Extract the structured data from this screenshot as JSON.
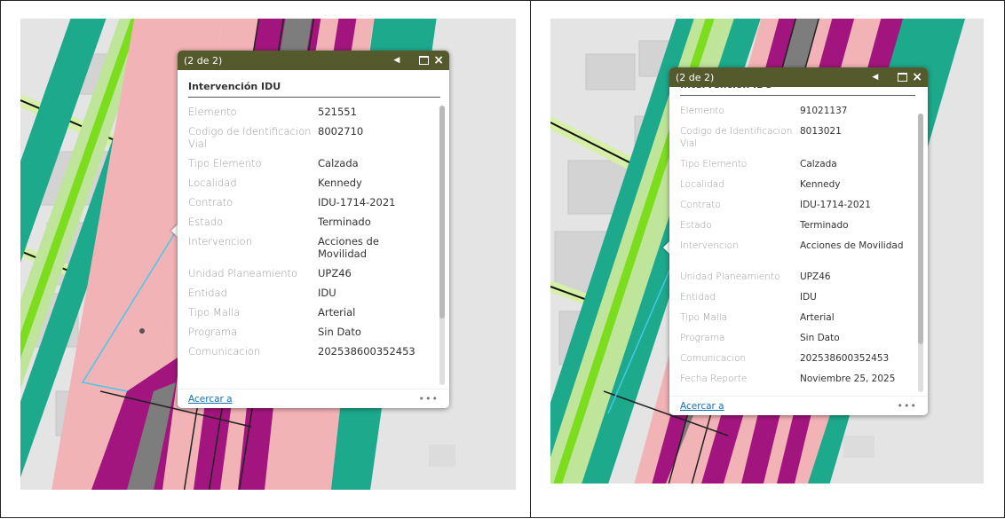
{
  "colors": {
    "header": "#555a2c",
    "road_pink": "#f2b3b6",
    "road_magenta": "#a3157e",
    "road_gray": "#7d7d7d",
    "road_green": "#1da98c",
    "lime": "#7cdc1e"
  },
  "left": {
    "counter": "(2 de 2)",
    "title": "Intervención IDU",
    "rows": [
      {
        "label": "Elemento",
        "value": "521551"
      },
      {
        "label": "Codigo de Identificacion Vial",
        "value": "8002710"
      },
      {
        "label": "Tipo Elemento",
        "value": "Calzada"
      },
      {
        "label": "Localidad",
        "value": "Kennedy"
      },
      {
        "label": "Contrato",
        "value": "IDU-1714-2021"
      },
      {
        "label": "Estado",
        "value": "Terminado"
      },
      {
        "label": "Intervencion",
        "value": "Acciones de Movilidad"
      },
      {
        "label": "Unidad Planeamiento",
        "value": "UPZ46"
      },
      {
        "label": "Entidad",
        "value": "IDU"
      },
      {
        "label": "Tipo Malla",
        "value": "Arterial"
      },
      {
        "label": "Programa",
        "value": "Sin Dato"
      },
      {
        "label": "Comunicacion",
        "value": "202538600352453"
      }
    ],
    "zoom_label": "Acercar a",
    "more": "•••"
  },
  "right": {
    "counter": "(2 de 2)",
    "title": "Intervención IDU",
    "rows": [
      {
        "label": "Elemento",
        "value": "91021137"
      },
      {
        "label": "Codigo de Identificacion Vial",
        "value": "8013021"
      },
      {
        "label": "Tipo Elemento",
        "value": "Calzada"
      },
      {
        "label": "Localidad",
        "value": "Kennedy"
      },
      {
        "label": "Contrato",
        "value": "IDU-1714-2021"
      },
      {
        "label": "Estado",
        "value": "Terminado"
      },
      {
        "label": "Intervencion",
        "value": "Acciones de Movilidad"
      },
      {
        "label": "Unidad Planeamiento",
        "value": "UPZ46"
      },
      {
        "label": "Entidad",
        "value": "IDU"
      },
      {
        "label": "Tipo Malla",
        "value": "Arterial"
      },
      {
        "label": "Programa",
        "value": "Sin Dato"
      },
      {
        "label": "Comunicacion",
        "value": "202538600352453"
      },
      {
        "label": "Fecha Reporte",
        "value": "Noviembre 25, 2025"
      }
    ],
    "zoom_label": "Acercar a",
    "more": "•••"
  }
}
